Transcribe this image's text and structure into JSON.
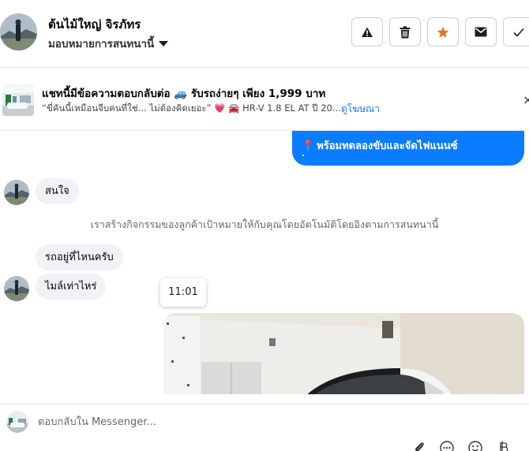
{
  "header": {
    "contact_name": "ต้นไม้ใหญ่ จิรภัทร",
    "assign_label": "มอบหมายการสนทนานี้",
    "tools": [
      {
        "icon": "warning-icon"
      },
      {
        "icon": "trash-icon"
      },
      {
        "icon": "star-icon",
        "color": "#e4762b"
      },
      {
        "icon": "mail-icon"
      },
      {
        "icon": "check-icon"
      }
    ]
  },
  "ad": {
    "title": "แชทนี้มีข้อความตอบกลับต่อ 🚙 รับรถง่ายๆ เพียง 1,999 บาท",
    "subtitle": "“ขี่คันนี้เหมือนจีบคนที่ใช่... ไม่ต้องคิดเยอะ” 💗 🚘 HR-V 1.8 EL AT ปี 20...",
    "link": "ดูโฆษณา",
    "close": "×"
  },
  "chat": {
    "outgoing_text": "พร้อมทดลองขับและจัดไฟแนนซ์",
    "outgoing_dot": ".",
    "incoming_1": "สนใจ",
    "system_note": "เราสร้างกิจกรรมของลูกค้าเป้าหมายให้กับคุณโดยอัตโนมัติโดยอิงตามการสนทนานี้",
    "incoming_2": "รถอยู่ที่ไหนครับ",
    "incoming_3": "ไมล์เท่าไหร่",
    "timestamp": "11:01"
  },
  "composer": {
    "placeholder": "ตอบกลับใน Messenger...",
    "tools": [
      "attach-icon",
      "more-icon",
      "emoji-icon",
      "currency-icon"
    ]
  },
  "colors": {
    "accent": "#0a7cff",
    "link": "#1877f2",
    "incoming_bubble": "#f0f2f5",
    "star": "#e4762b"
  }
}
